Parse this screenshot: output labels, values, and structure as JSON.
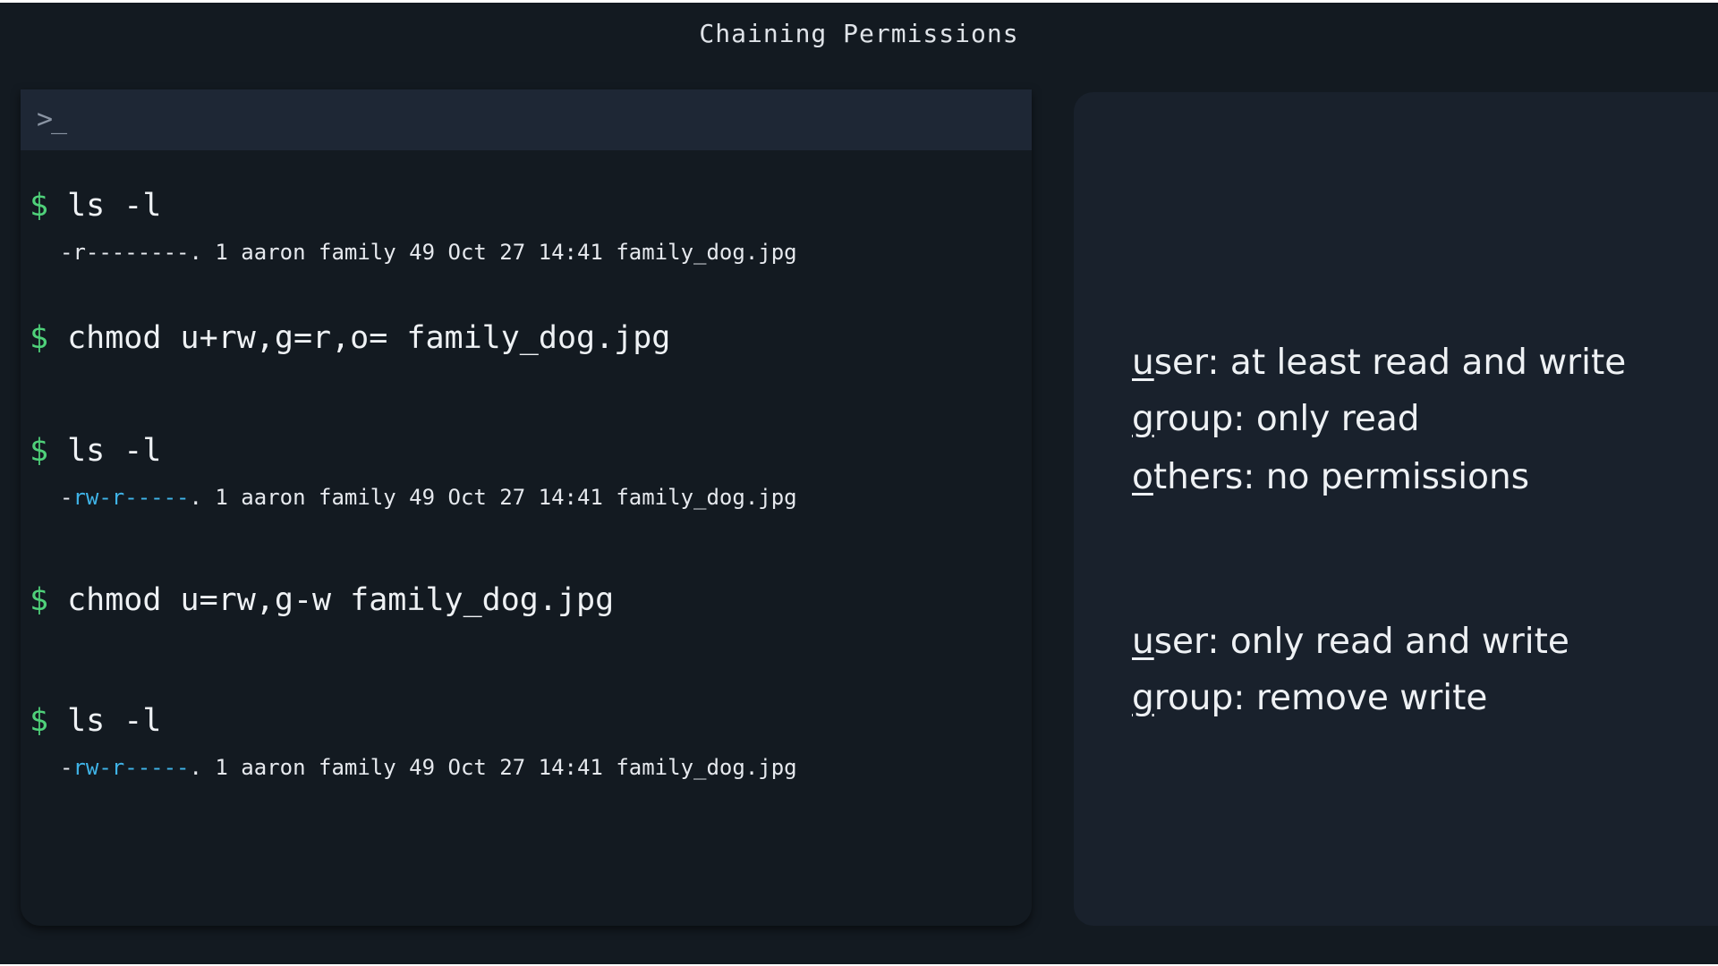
{
  "title": "Chaining Permissions",
  "terminal": {
    "prompt_icon": "terminal-prompt-icon",
    "prompt_symbol": ">_",
    "dollar": "$",
    "commands": [
      {
        "cmd": "ls -l"
      },
      {
        "cmd": "chmod u+rw,g=r,o= family_dog.jpg"
      },
      {
        "cmd": "ls -l"
      },
      {
        "cmd": "chmod u=rw,g-w family_dog.jpg"
      },
      {
        "cmd": "ls -l"
      }
    ],
    "outputs": [
      {
        "perm_prefix": "-r--------.",
        "perm_colored": "",
        "perm_rest": "",
        "rest": " 1 aaron family 49 Oct 27 14:41 family_dog.jpg"
      },
      {
        "perm_prefix": "-",
        "perm_colored": "rw-r-----",
        "perm_rest": ".",
        "rest": " 1 aaron family 49 Oct 27 14:41 family_dog.jpg"
      },
      {
        "perm_prefix": "-",
        "perm_colored": "rw-r-----",
        "perm_rest": ".",
        "rest": " 1 aaron family 49 Oct 27 14:41 family_dog.jpg"
      }
    ]
  },
  "notes": {
    "block1": [
      {
        "first": "u",
        "rest": "ser: at least read and write"
      },
      {
        "first": "g",
        "rest": "roup: only read"
      },
      {
        "first": "o",
        "rest": "thers: no permissions"
      }
    ],
    "block2": [
      {
        "first": "u",
        "rest": "ser: only read and write"
      },
      {
        "first": "g",
        "rest": "roup: remove write"
      }
    ]
  },
  "colors": {
    "background": "#131a21",
    "terminal_header": "#1e2735",
    "notes_panel": "#19212c",
    "prompt_green": "#4fd17a",
    "permission_blue": "#3fb4e8"
  }
}
